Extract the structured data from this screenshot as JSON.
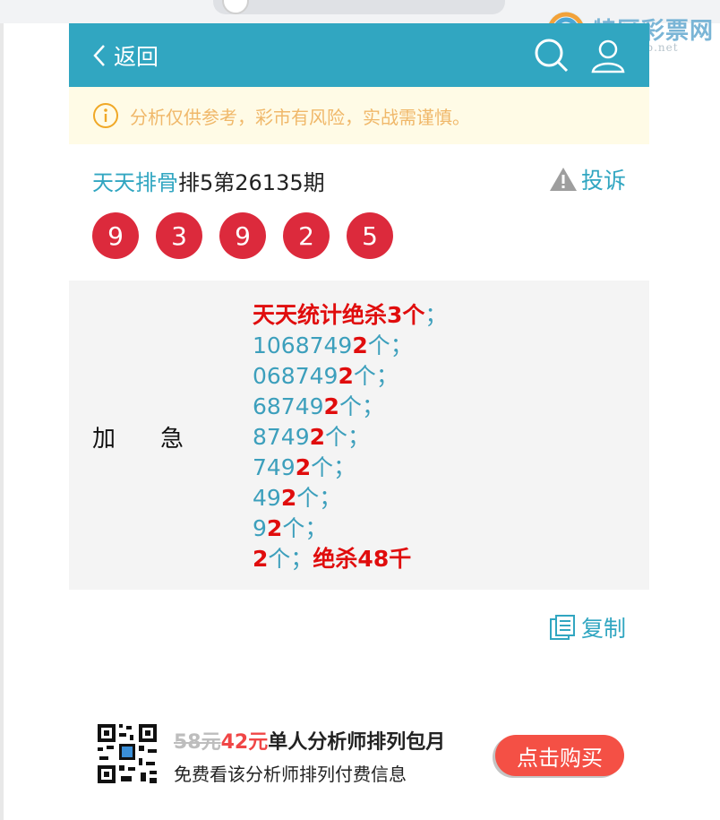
{
  "logo": {
    "text": "特区彩票网",
    "url": "www.tqcp.net"
  },
  "header": {
    "back_label": "返回",
    "icons": [
      "search-icon",
      "user-icon"
    ]
  },
  "notice": {
    "text": "分析仅供参考，彩市有风险，实战需谨慎。"
  },
  "issue": {
    "author": "天天排骨",
    "title": "排5第26135期",
    "complain_label": "投诉"
  },
  "balls": [
    "9",
    "3",
    "9",
    "2",
    "5"
  ],
  "content": {
    "label_a": "加",
    "label_b": "急",
    "line1_red": "天天统计绝杀3个",
    "line1_tail": "；",
    "lines": [
      {
        "prefix": "1068749",
        "digit": "2",
        "suffix": "个；"
      },
      {
        "prefix": "068749",
        "digit": "2",
        "suffix": "个；"
      },
      {
        "prefix": "68749",
        "digit": "2",
        "suffix": "个；"
      },
      {
        "prefix": "8749",
        "digit": "2",
        "suffix": "个；"
      },
      {
        "prefix": "749",
        "digit": "2",
        "suffix": "个；"
      },
      {
        "prefix": "49",
        "digit": "2",
        "suffix": "个；"
      },
      {
        "prefix": "9",
        "digit": "2",
        "suffix": "个；"
      }
    ],
    "last_digit": "2",
    "last_mid": "个；",
    "last_red": "绝杀48千"
  },
  "copy_label": "复制",
  "promo": {
    "old_price": "58元",
    "new_price": "42元",
    "title": "单人分析师排列包月",
    "subtitle": "免费看该分析师排列付费信息",
    "buy_label": "点击购买"
  },
  "colors": {
    "header": "#31a6c1",
    "ball": "#dc2a3c",
    "notice_bg": "#fffbe6",
    "notice_text": "#f0b86a",
    "red_text": "#e00d0d",
    "buy_button": "#f45045"
  }
}
